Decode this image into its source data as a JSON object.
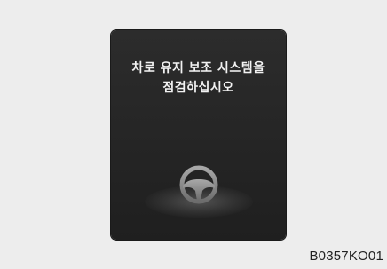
{
  "display": {
    "message_line1": "차로 유지 보조 시스템을",
    "message_line2": "점검하십시오",
    "icon": "steering-wheel-icon"
  },
  "figure": {
    "code": "B0357KO01"
  },
  "colors": {
    "background": "#ededed",
    "screen": "#262626",
    "text": "#f2f2f2",
    "icon": "#8a8a8a"
  }
}
